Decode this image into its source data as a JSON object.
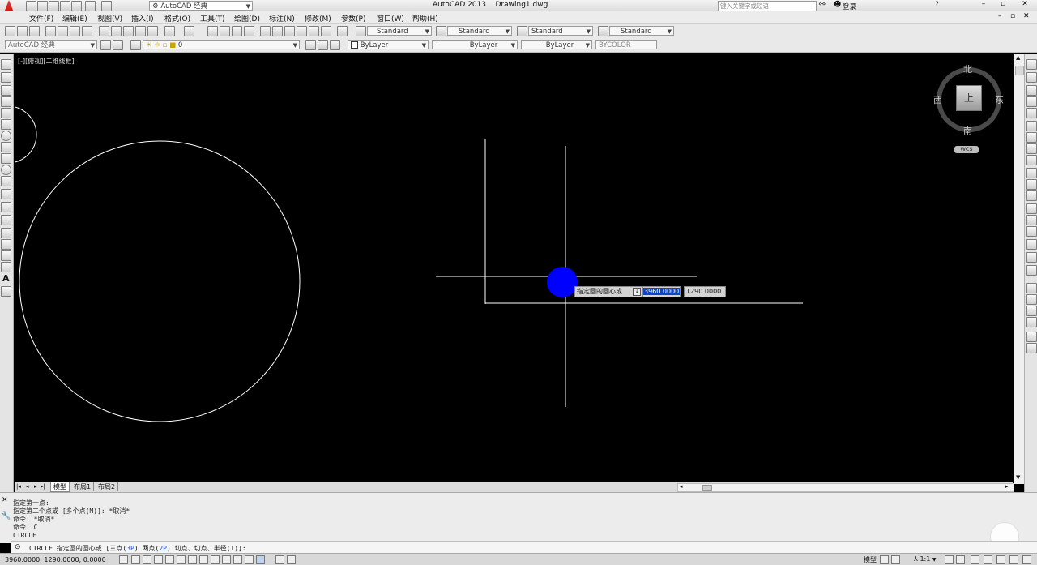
{
  "title_bar": {
    "workspace": "AutoCAD 经典",
    "app_title": "AutoCAD 2013",
    "document": "Drawing1.dwg",
    "search_placeholder": "键入关键字或短语",
    "login": "登录"
  },
  "menu": [
    "文件(F)",
    "编辑(E)",
    "视图(V)",
    "插入(I)",
    "格式(O)",
    "工具(T)",
    "绘图(D)",
    "标注(N)",
    "修改(M)",
    "参数(P)",
    "窗口(W)",
    "帮助(H)"
  ],
  "styles_toolbar": {
    "text_style": "Standard",
    "dim_style": "Standard",
    "table_style": "Standard",
    "multileader_style": "Standard"
  },
  "layers_toolbar": {
    "workspace": "AutoCAD 经典",
    "layer": "0",
    "color": "ByLayer",
    "linetype": "ByLayer",
    "lineweight": "ByLayer",
    "plot_style": "BYCOLOR"
  },
  "viewport": {
    "label": "[-][俯视][二维线框]"
  },
  "viewcube": {
    "north": "北",
    "south": "南",
    "east": "东",
    "west": "西",
    "top": "上",
    "wcs": "WCS"
  },
  "dynamic_input": {
    "prompt": "指定圆的圆心或",
    "x_value": "3960.0000",
    "y_value": "1290.0000"
  },
  "tabs": [
    "模型",
    "布局1",
    "布局2"
  ],
  "command_history": [
    "指定第一点:",
    "指定第二个点或 [多个点(M)]: *取消*",
    "命令: *取消*",
    "命令: C",
    "CIRCLE"
  ],
  "command_line": {
    "command": "CIRCLE",
    "prompt": "指定圆的圆心或 [",
    "opt1_text": "三点(",
    "opt1_key": "3P",
    "opt1_end": ")",
    "opt2_text": "两点(",
    "opt2_key": "2P",
    "opt2_end": ")",
    "rest": "切点、切点、半径(T)]:"
  },
  "status": {
    "coordinates": "3960.0000, 1290.0000, 0.0000",
    "model": "模型",
    "scale": "1:1"
  },
  "colors": {
    "canvas": "#000000",
    "highlight_dot": "#0000ff",
    "selection": "#0a46c8"
  }
}
